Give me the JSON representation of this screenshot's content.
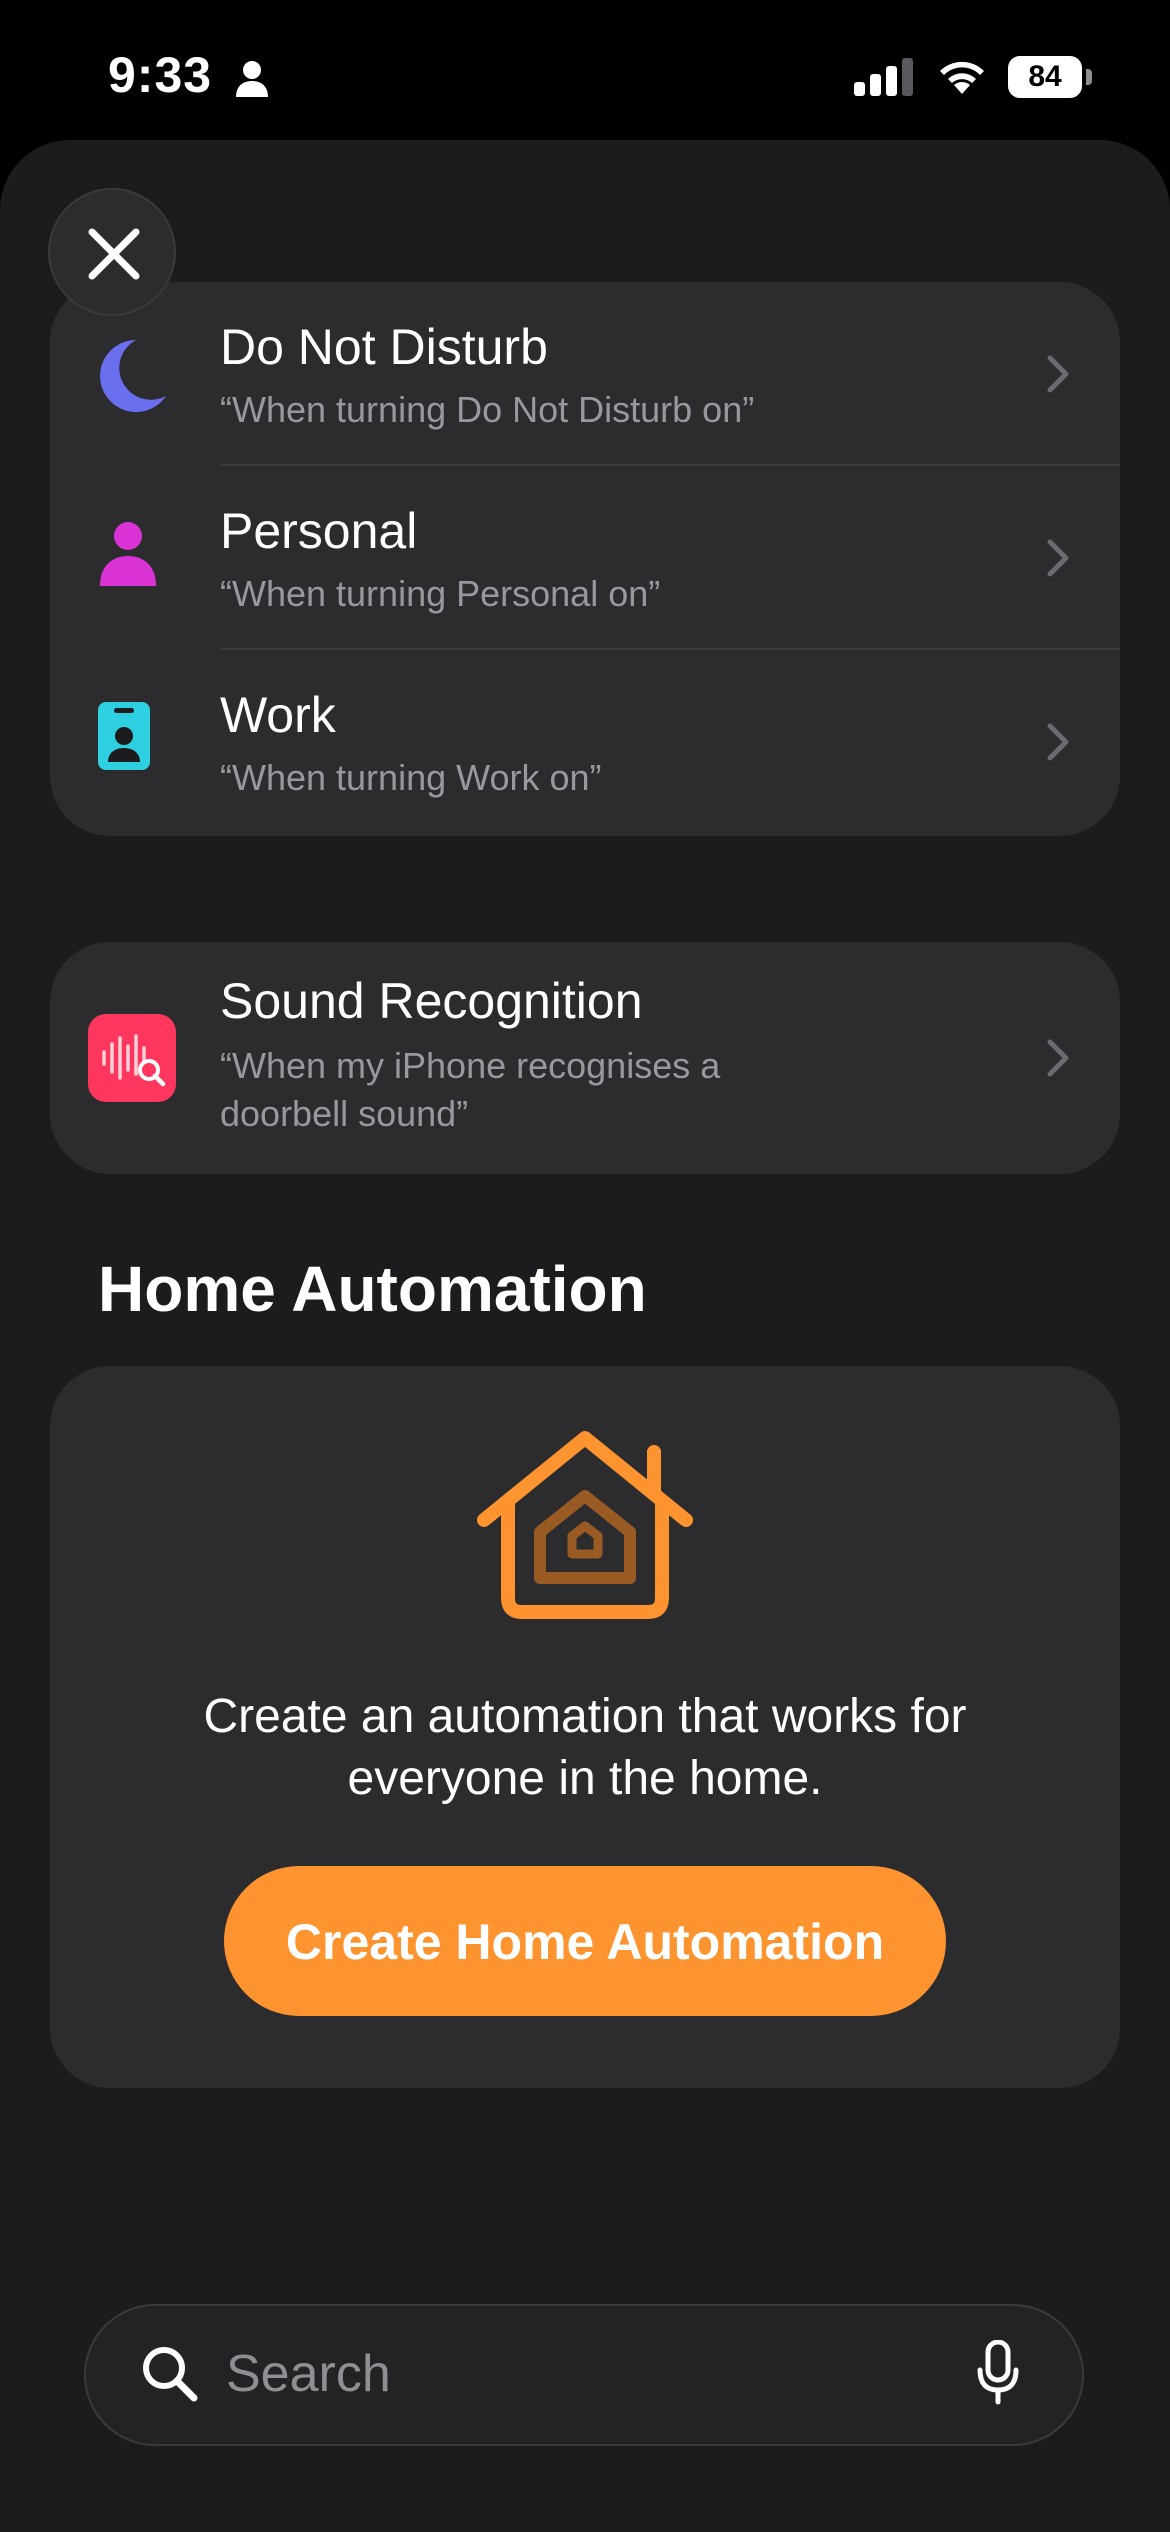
{
  "status_bar": {
    "time": "9:33",
    "battery": "84"
  },
  "focus_triggers": [
    {
      "title": "Do Not Disturb",
      "subtitle": "“When turning Do Not Disturb on”",
      "icon": "moon-icon",
      "color": "#6a6ff0"
    },
    {
      "title": "Personal",
      "subtitle": "“When turning Personal on”",
      "icon": "person-icon",
      "color": "#d933d5"
    },
    {
      "title": "Work",
      "subtitle": "“When turning Work on”",
      "icon": "id-badge-icon",
      "color": "#2ecfe0"
    }
  ],
  "sound_recognition": {
    "title": "Sound Recognition",
    "subtitle_line1": "“When my iPhone recognises a",
    "subtitle_line2": "doorbell sound”",
    "icon": "sound-recognition-icon",
    "color": "#ff375f"
  },
  "home_automation": {
    "section_title": "Home Automation",
    "description_line1": "Create an automation that works for",
    "description_line2": "everyone in the home.",
    "button_label": "Create Home Automation",
    "icon": "home-icon",
    "accent": "#fe9430"
  },
  "search": {
    "placeholder": "Search"
  }
}
